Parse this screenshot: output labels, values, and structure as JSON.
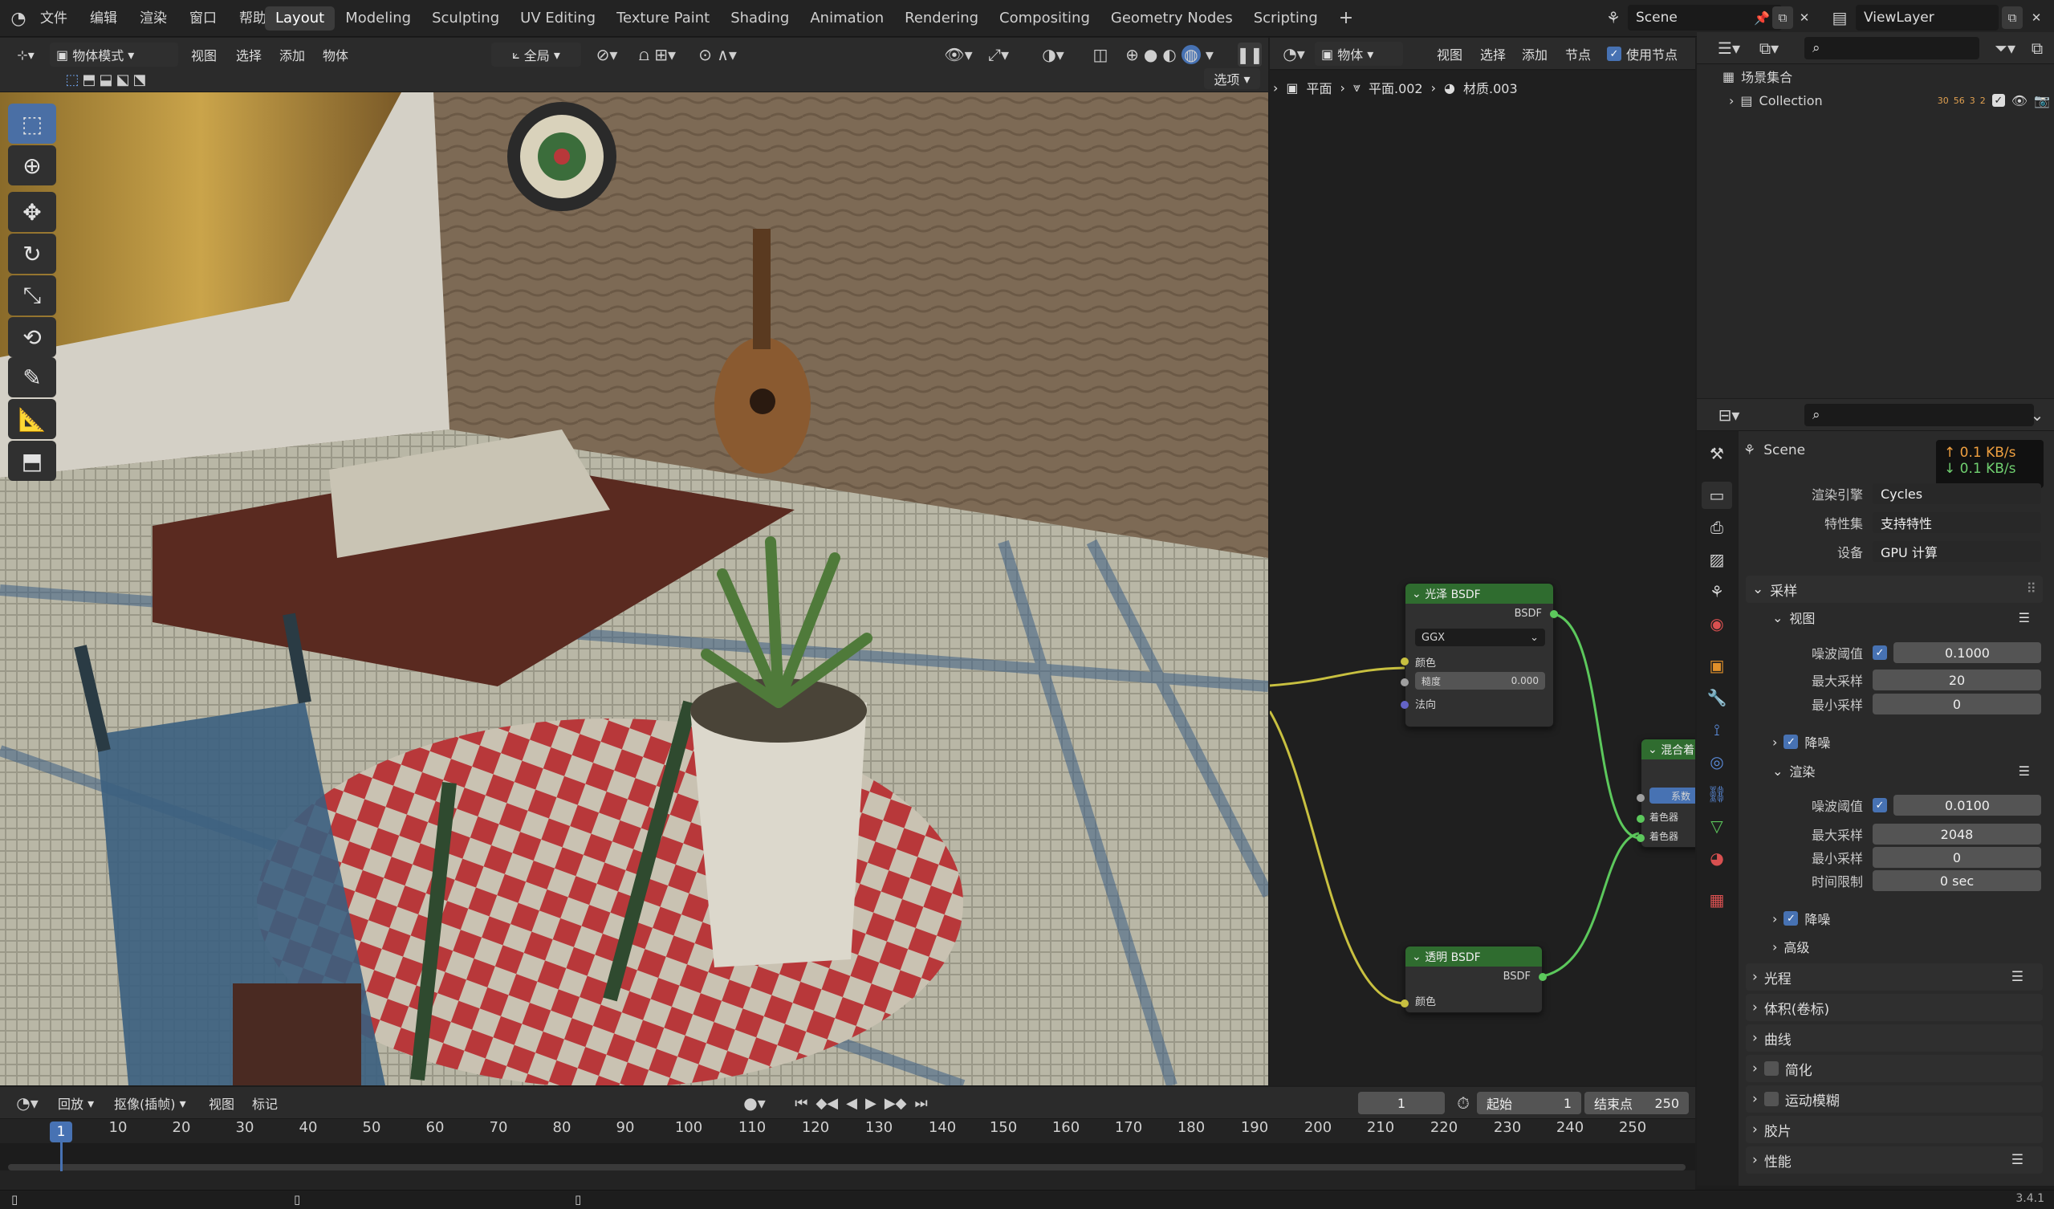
{
  "app": {
    "menus": [
      "文件",
      "编辑",
      "渲染",
      "窗口",
      "帮助"
    ],
    "workspaces": [
      "Layout",
      "Modeling",
      "Sculpting",
      "UV Editing",
      "Texture Paint",
      "Shading",
      "Animation",
      "Rendering",
      "Compositing",
      "Geometry Nodes",
      "Scripting"
    ],
    "active_workspace": "Layout",
    "scene": "Scene",
    "view_layer": "ViewLayer",
    "version": "3.4.1"
  },
  "viewport": {
    "mode": "物体模式",
    "menus": [
      "视图",
      "选择",
      "添加",
      "物体"
    ],
    "orientation": "全局",
    "options": "选项"
  },
  "node_editor": {
    "type": "物体",
    "menus": [
      "视图",
      "选择",
      "添加",
      "节点"
    ],
    "use_nodes": "使用节点",
    "breadcrumb": [
      "平面",
      "平面.002",
      "材质.003"
    ],
    "glossy": {
      "title": "光泽 BSDF",
      "output": "BSDF",
      "distribution": "GGX",
      "color": "颜色",
      "roughness_label": "糙度",
      "roughness": "0.000",
      "normal": "法向"
    },
    "transparent": {
      "title": "透明 BSDF",
      "output": "BSDF",
      "color": "颜色"
    },
    "mix": {
      "title": "混合着",
      "fac": "系数",
      "shader1": "着色器",
      "shader2": "着色器"
    }
  },
  "outliner": {
    "root": "场景集合",
    "collection": "Collection",
    "counts": [
      "30",
      "56",
      "3",
      "2"
    ]
  },
  "network": {
    "up": "↑ 0.1 KB/s",
    "down": "↓ 0.1 KB/s"
  },
  "properties": {
    "title": "Scene",
    "engine_label": "渲染引擎",
    "engine": "Cycles",
    "feature_label": "特性集",
    "feature": "支持特性",
    "device_label": "设备",
    "device": "GPU 计算",
    "sampling": "采样",
    "viewport": "视图",
    "noise_label": "噪波阈值",
    "vp_noise": "0.1000",
    "max_label": "最大采样",
    "vp_max": "20",
    "min_label": "最小采样",
    "vp_min": "0",
    "denoise": "降噪",
    "render": "渲染",
    "r_noise": "0.0100",
    "r_max": "2048",
    "r_min": "0",
    "time_label": "时间限制",
    "time": "0 sec",
    "advanced": "高级",
    "light_paths": "光程",
    "volumes": "体积(卷标)",
    "curves": "曲线",
    "simplify": "简化",
    "motion_blur": "运动模糊",
    "film": "胶片",
    "performance": "性能"
  },
  "timeline": {
    "playback": "回放",
    "keying": "抠像(插帧)",
    "view": "视图",
    "marker": "标记",
    "current": "1",
    "start_label": "起始",
    "start": "1",
    "end_label": "结束点",
    "end": "250",
    "ticks": [
      "10",
      "20",
      "30",
      "40",
      "50",
      "60",
      "70",
      "80",
      "90",
      "100",
      "110",
      "120",
      "130",
      "140",
      "150",
      "160",
      "170",
      "180",
      "190",
      "200",
      "210",
      "220",
      "230",
      "240",
      "250"
    ]
  },
  "colors": {
    "accent": "#4772b3",
    "node_header": "#2f6c2f",
    "yellow_link": "#c8c040",
    "green_link": "#5cc85c"
  }
}
